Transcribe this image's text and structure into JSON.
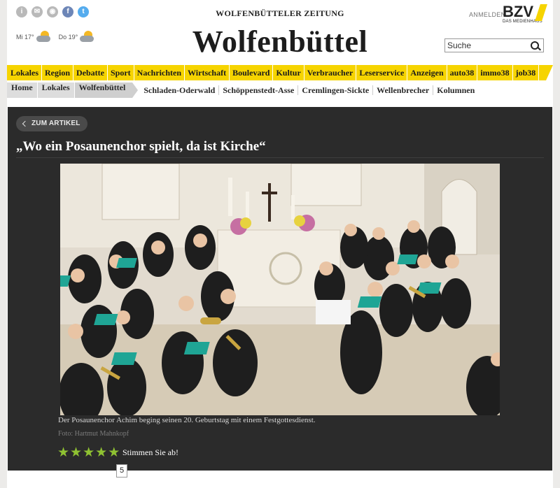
{
  "header": {
    "social_icons": [
      "info-icon",
      "email-icon",
      "rss-icon",
      "facebook-icon",
      "twitter-icon"
    ],
    "weather": [
      {
        "day": "Mi 17°",
        "icon": "sun-rain-icon"
      },
      {
        "day": "Do 19°",
        "icon": "sun-rain-icon"
      }
    ],
    "brand_top": "WOLFENBÜTTELER ZEITUNG",
    "brand_main": "Wolfenbüttel",
    "login": "ANMELDEN",
    "logo_text": "BZV",
    "logo_sub": "DAS MEDIENHAUS",
    "search_placeholder": "Suche"
  },
  "nav": {
    "items": [
      "Lokales",
      "Region",
      "Debatte",
      "Sport",
      "Nachrichten",
      "Wirtschaft",
      "Boulevard",
      "Kultur",
      "Verbraucher",
      "Leserservice",
      "Anzeigen",
      "auto38",
      "immo38",
      "job38"
    ]
  },
  "subnav": {
    "breadcrumb": [
      "Home",
      "Lokales",
      "Wolfenbüttel"
    ],
    "links": [
      "Schladen-Oderwald",
      "Schöppenstedt-Asse",
      "Cremlingen-Sickte",
      "Wellenbrecher",
      "Kolumnen"
    ]
  },
  "article": {
    "back_label": "ZUM ARTIKEL",
    "title": "„Wo ein Posaunenchor spielt, da ist Kirche“",
    "caption": "Der Posaunenchor Achim beging seinen 20. Geburtstag mit einem Festgottesdienst.",
    "credit": "Foto: Hartmut Mahnkopf",
    "rating": {
      "stars": 5,
      "vote_label": "Stimmen Sie ab!",
      "count": "5"
    }
  },
  "colors": {
    "accent": "#f6d400",
    "star": "#8fc232",
    "panel": "#2b2b2b"
  }
}
